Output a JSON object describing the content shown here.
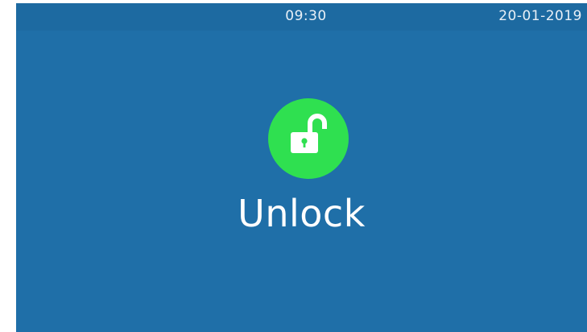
{
  "status_bar": {
    "time": "09:30",
    "date": "20-01-2019"
  },
  "main": {
    "icon": "unlocked-padlock-icon",
    "label": "Unlock"
  },
  "colors": {
    "background": "#1f6fa8",
    "icon_circle": "#2fe050",
    "text": "#ffffff"
  }
}
